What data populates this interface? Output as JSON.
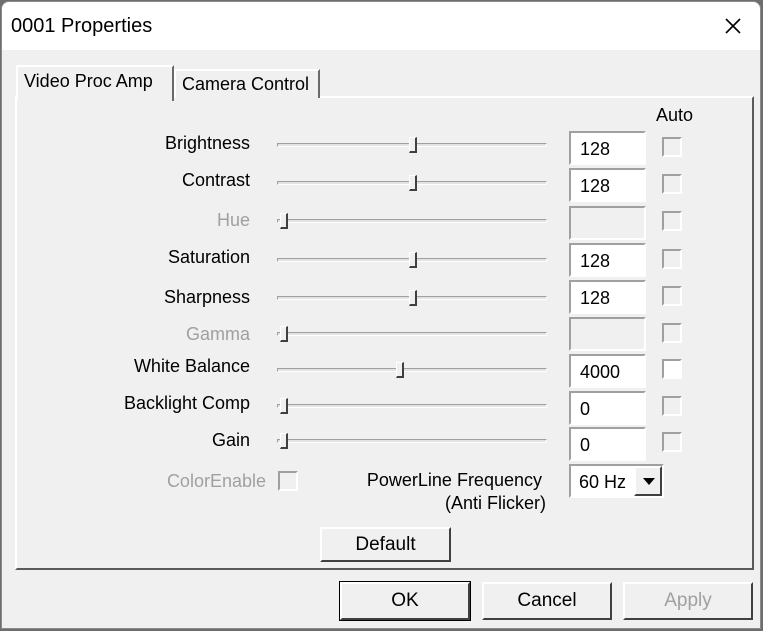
{
  "window": {
    "title": "0001 Properties"
  },
  "tabs": [
    {
      "label": "Video Proc Amp"
    },
    {
      "label": "Camera Control"
    }
  ],
  "auto_header": "Auto",
  "controls": [
    {
      "label": "Brightness",
      "value": "128",
      "slider_fraction": 0.5,
      "enabled": true
    },
    {
      "label": "Contrast",
      "value": "128",
      "slider_fraction": 0.5,
      "enabled": true
    },
    {
      "label": "Hue",
      "value": "",
      "slider_fraction": 0.0,
      "enabled": false
    },
    {
      "label": "Saturation",
      "value": "128",
      "slider_fraction": 0.5,
      "enabled": true
    },
    {
      "label": "Sharpness",
      "value": "128",
      "slider_fraction": 0.5,
      "enabled": true
    },
    {
      "label": "Gamma",
      "value": "",
      "slider_fraction": 0.0,
      "enabled": false
    },
    {
      "label": "White Balance",
      "value": "4000",
      "slider_fraction": 0.45,
      "enabled": true
    },
    {
      "label": "Backlight Comp",
      "value": "0",
      "slider_fraction": 0.0,
      "enabled": true
    },
    {
      "label": "Gain",
      "value": "0",
      "slider_fraction": 0.0,
      "enabled": true
    }
  ],
  "color_enable": {
    "label": "ColorEnable",
    "checked": false,
    "enabled": false
  },
  "powerline": {
    "label_line1": "PowerLine Frequency",
    "label_line2": "(Anti Flicker)",
    "selected": "60 Hz"
  },
  "buttons": {
    "default": "Default",
    "ok": "OK",
    "cancel": "Cancel",
    "apply": "Apply"
  },
  "colors": {
    "window_bg": "#f0f0f0",
    "titlebar_bg": "#ffffff",
    "disabled_text": "#a0a0a0"
  },
  "icons": {
    "close": "close-icon",
    "dropdown": "chevron-down-icon"
  }
}
